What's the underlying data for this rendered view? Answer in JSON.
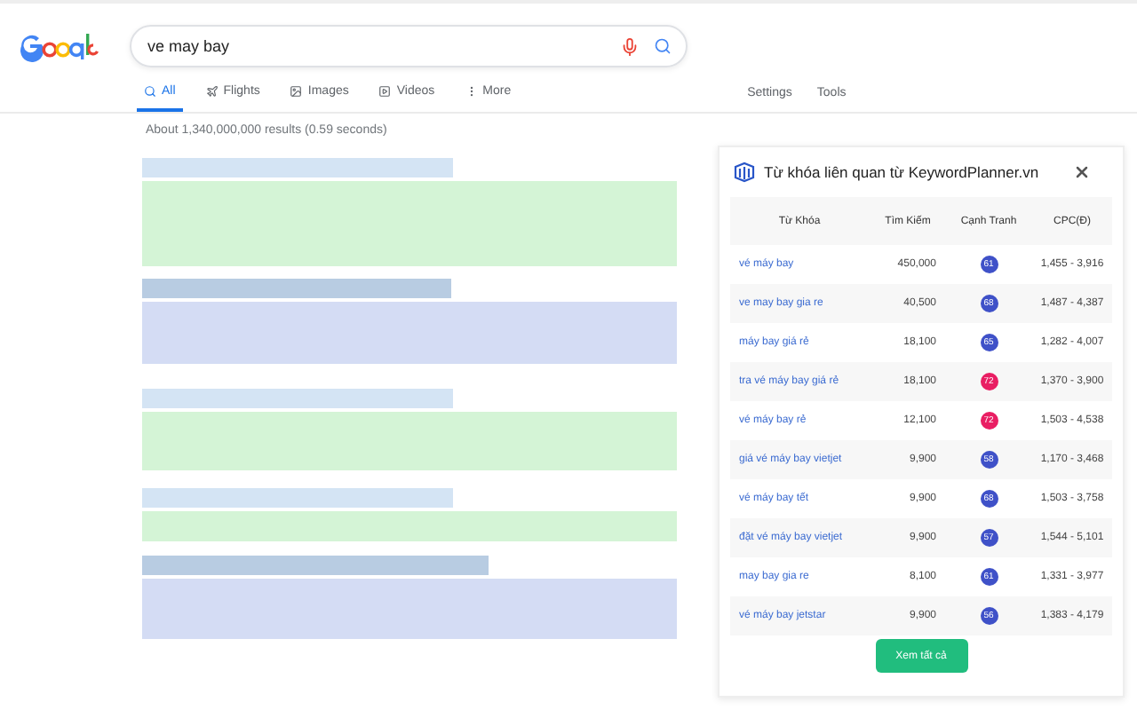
{
  "search": {
    "query": "ve may bay"
  },
  "tabs": [
    {
      "label": "All",
      "kind": "search",
      "selected": true
    },
    {
      "label": "Flights",
      "kind": "flights",
      "selected": false
    },
    {
      "label": "Images",
      "kind": "images",
      "selected": false
    },
    {
      "label": "Videos",
      "kind": "videos",
      "selected": false
    },
    {
      "label": "More",
      "kind": "more",
      "selected": false
    }
  ],
  "tools": [
    "Settings",
    "Tools"
  ],
  "result_stats": "About 1,340,000,000 results (0.59 seconds)",
  "results": [
    {
      "kind": "plain"
    },
    {
      "kind": "featured"
    },
    {
      "kind": "plain"
    },
    {
      "kind": "plain"
    },
    {
      "kind": "featured"
    }
  ],
  "panel": {
    "title": "Từ khóa liên quan từ KeywordPlanner.vn",
    "columns": [
      "Từ Khóa",
      "Tìm Kiếm",
      "Cạnh Tranh",
      "CPC(Đ)"
    ],
    "rows": [
      {
        "keyword": "vé máy bay",
        "searches": "450,000",
        "competition": "61",
        "color": "#3f51c8",
        "cpc": "1,455 - 3,916"
      },
      {
        "keyword": "ve may bay gia re",
        "searches": "40,500",
        "competition": "68",
        "color": "#3f51c8",
        "cpc": "1,487 - 4,387"
      },
      {
        "keyword": "máy bay giá rẻ",
        "searches": "18,100",
        "competition": "65",
        "color": "#3f51c8",
        "cpc": "1,282 - 4,007"
      },
      {
        "keyword": "tra vé máy bay giá rẻ",
        "searches": "18,100",
        "competition": "72",
        "color": "#e91e63",
        "cpc": "1,370 - 3,900"
      },
      {
        "keyword": "vé máy bay rẻ",
        "searches": "12,100",
        "competition": "72",
        "color": "#e91e63",
        "cpc": "1,503 - 4,538"
      },
      {
        "keyword": "giá vé máy bay vietjet",
        "searches": "9,900",
        "competition": "58",
        "color": "#3f51c8",
        "cpc": "1,170 - 3,468"
      },
      {
        "keyword": "vé máy bay tết",
        "searches": "9,900",
        "competition": "68",
        "color": "#3f51c8",
        "cpc": "1,503 - 3,758"
      },
      {
        "keyword": "đặt vé máy bay vietjet",
        "searches": "9,900",
        "competition": "57",
        "color": "#3f51c8",
        "cpc": "1,544 - 5,101"
      },
      {
        "keyword": "may bay gia re",
        "searches": "8,100",
        "competition": "61",
        "color": "#3f51c8",
        "cpc": "1,331 - 3,977"
      },
      {
        "keyword": "vé máy bay jetstar",
        "searches": "9,900",
        "competition": "56",
        "color": "#3f51c8",
        "cpc": "1,383 - 4,179"
      }
    ],
    "button": "Xem tất cả"
  }
}
